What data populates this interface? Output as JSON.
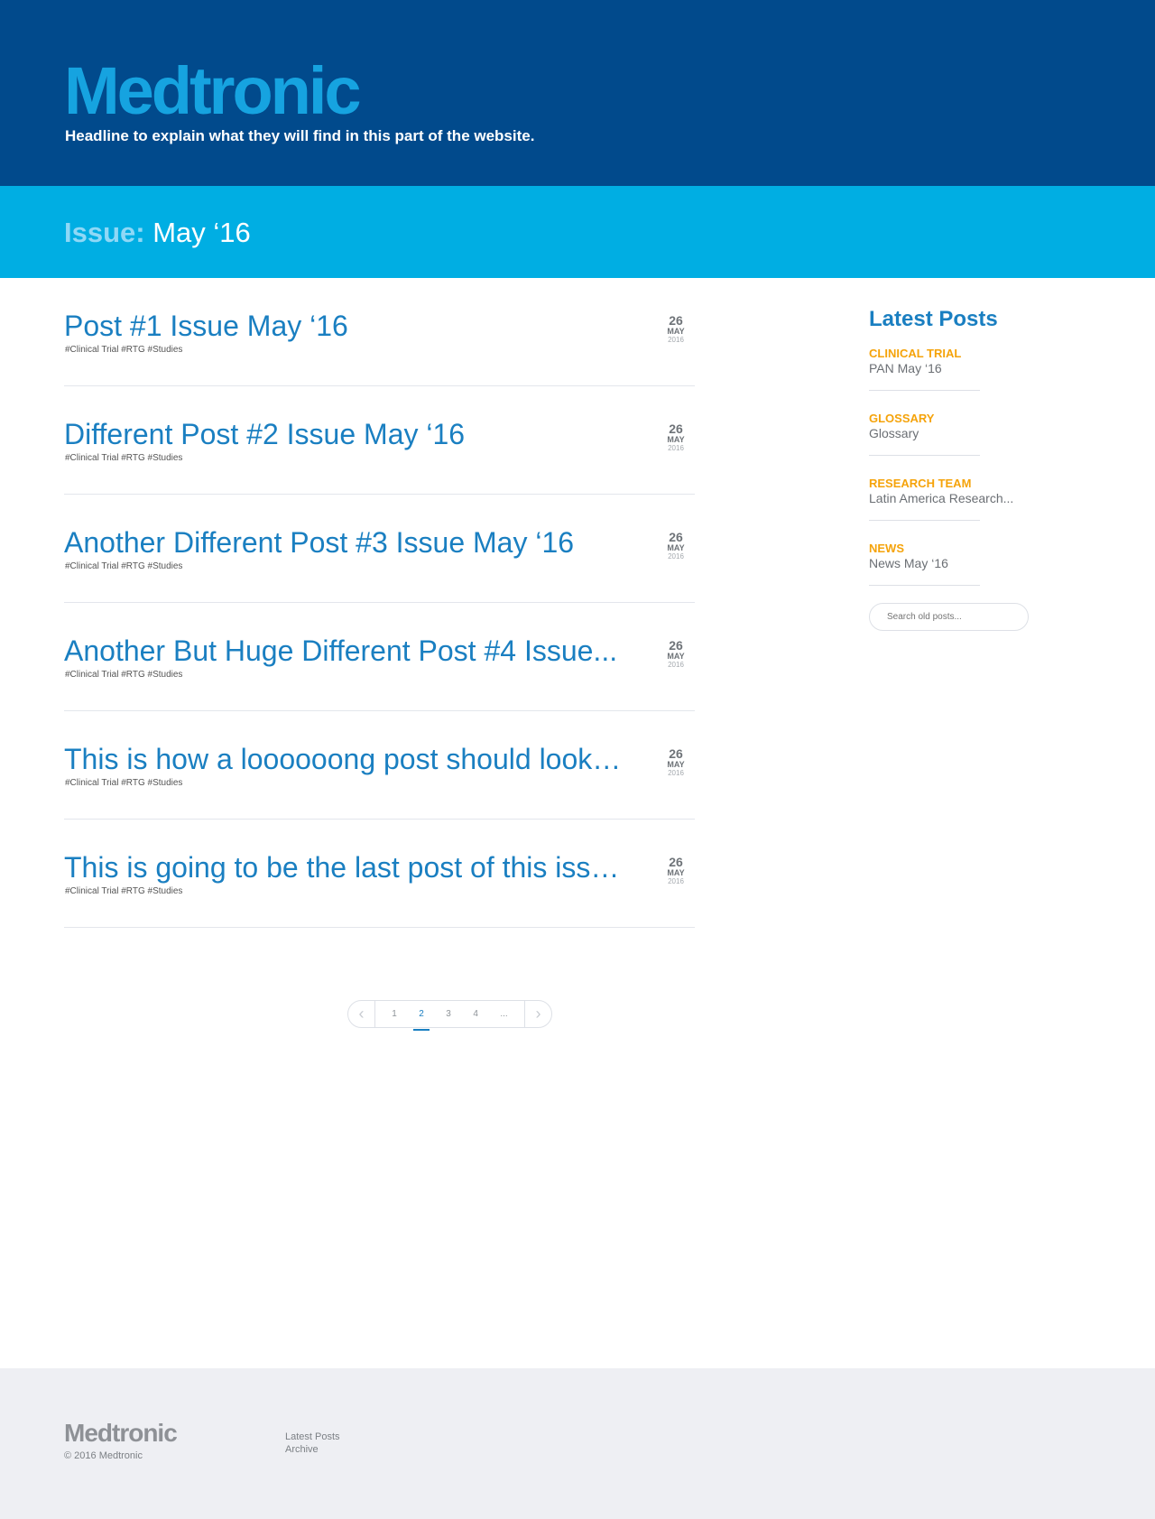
{
  "header": {
    "logo": "Medtronic",
    "tagline": "Headline to explain what they will find in this part of the website."
  },
  "issue": {
    "label": "Issue:",
    "value": "May ‘16"
  },
  "posts": [
    {
      "title": "Post #1 Issue May ‘16",
      "tags": "#Clinical Trial #RTG #Studies",
      "day": "26",
      "month": "MAY",
      "year": "2016"
    },
    {
      "title": "Different Post #2 Issue May ‘16",
      "tags": "#Clinical Trial #RTG #Studies",
      "day": "26",
      "month": "MAY",
      "year": "2016"
    },
    {
      "title": "Another Different Post #3 Issue May ‘16",
      "tags": "#Clinical Trial #RTG #Studies",
      "day": "26",
      "month": "MAY",
      "year": "2016"
    },
    {
      "title": "Another But Huge Different Post #4 Issue...",
      "tags": "#Clinical Trial #RTG #Studies",
      "day": "26",
      "month": "MAY",
      "year": "2016"
    },
    {
      "title": "This is how a loooooong post should look li...",
      "tags": "#Clinical Trial #RTG #Studies",
      "day": "26",
      "month": "MAY",
      "year": "2016"
    },
    {
      "title": "This is going to be the last post of this issu...",
      "tags": "#Clinical Trial #RTG #Studies",
      "day": "26",
      "month": "MAY",
      "year": "2016"
    }
  ],
  "pagination": {
    "prev_icon": "chevron-left-icon",
    "next_icon": "chevron-right-icon",
    "pages": [
      "1",
      "2",
      "3",
      "4",
      "..."
    ],
    "active_page": "2"
  },
  "sidebar": {
    "title": "Latest Posts",
    "items": [
      {
        "category": "CLINICAL TRIAL",
        "post": "PAN May ‘16"
      },
      {
        "category": "GLOSSARY",
        "post": "Glossary"
      },
      {
        "category": "RESEARCH TEAM",
        "post": "Latin America Research..."
      },
      {
        "category": "NEWS",
        "post": "News May ‘16"
      }
    ],
    "search_placeholder": "Search old posts..."
  },
  "footer": {
    "logo": "Medtronic",
    "copyright": "© 2016 Medtronic",
    "links": [
      "Latest Posts",
      "Archive"
    ]
  },
  "colors": {
    "header_bg": "#014a8c",
    "logo": "#16a3e0",
    "issue_bar_bg": "#00aee3",
    "post_title": "#1a7fc1",
    "category_accent": "#f5a30a",
    "footer_bg": "#eeeff3"
  }
}
